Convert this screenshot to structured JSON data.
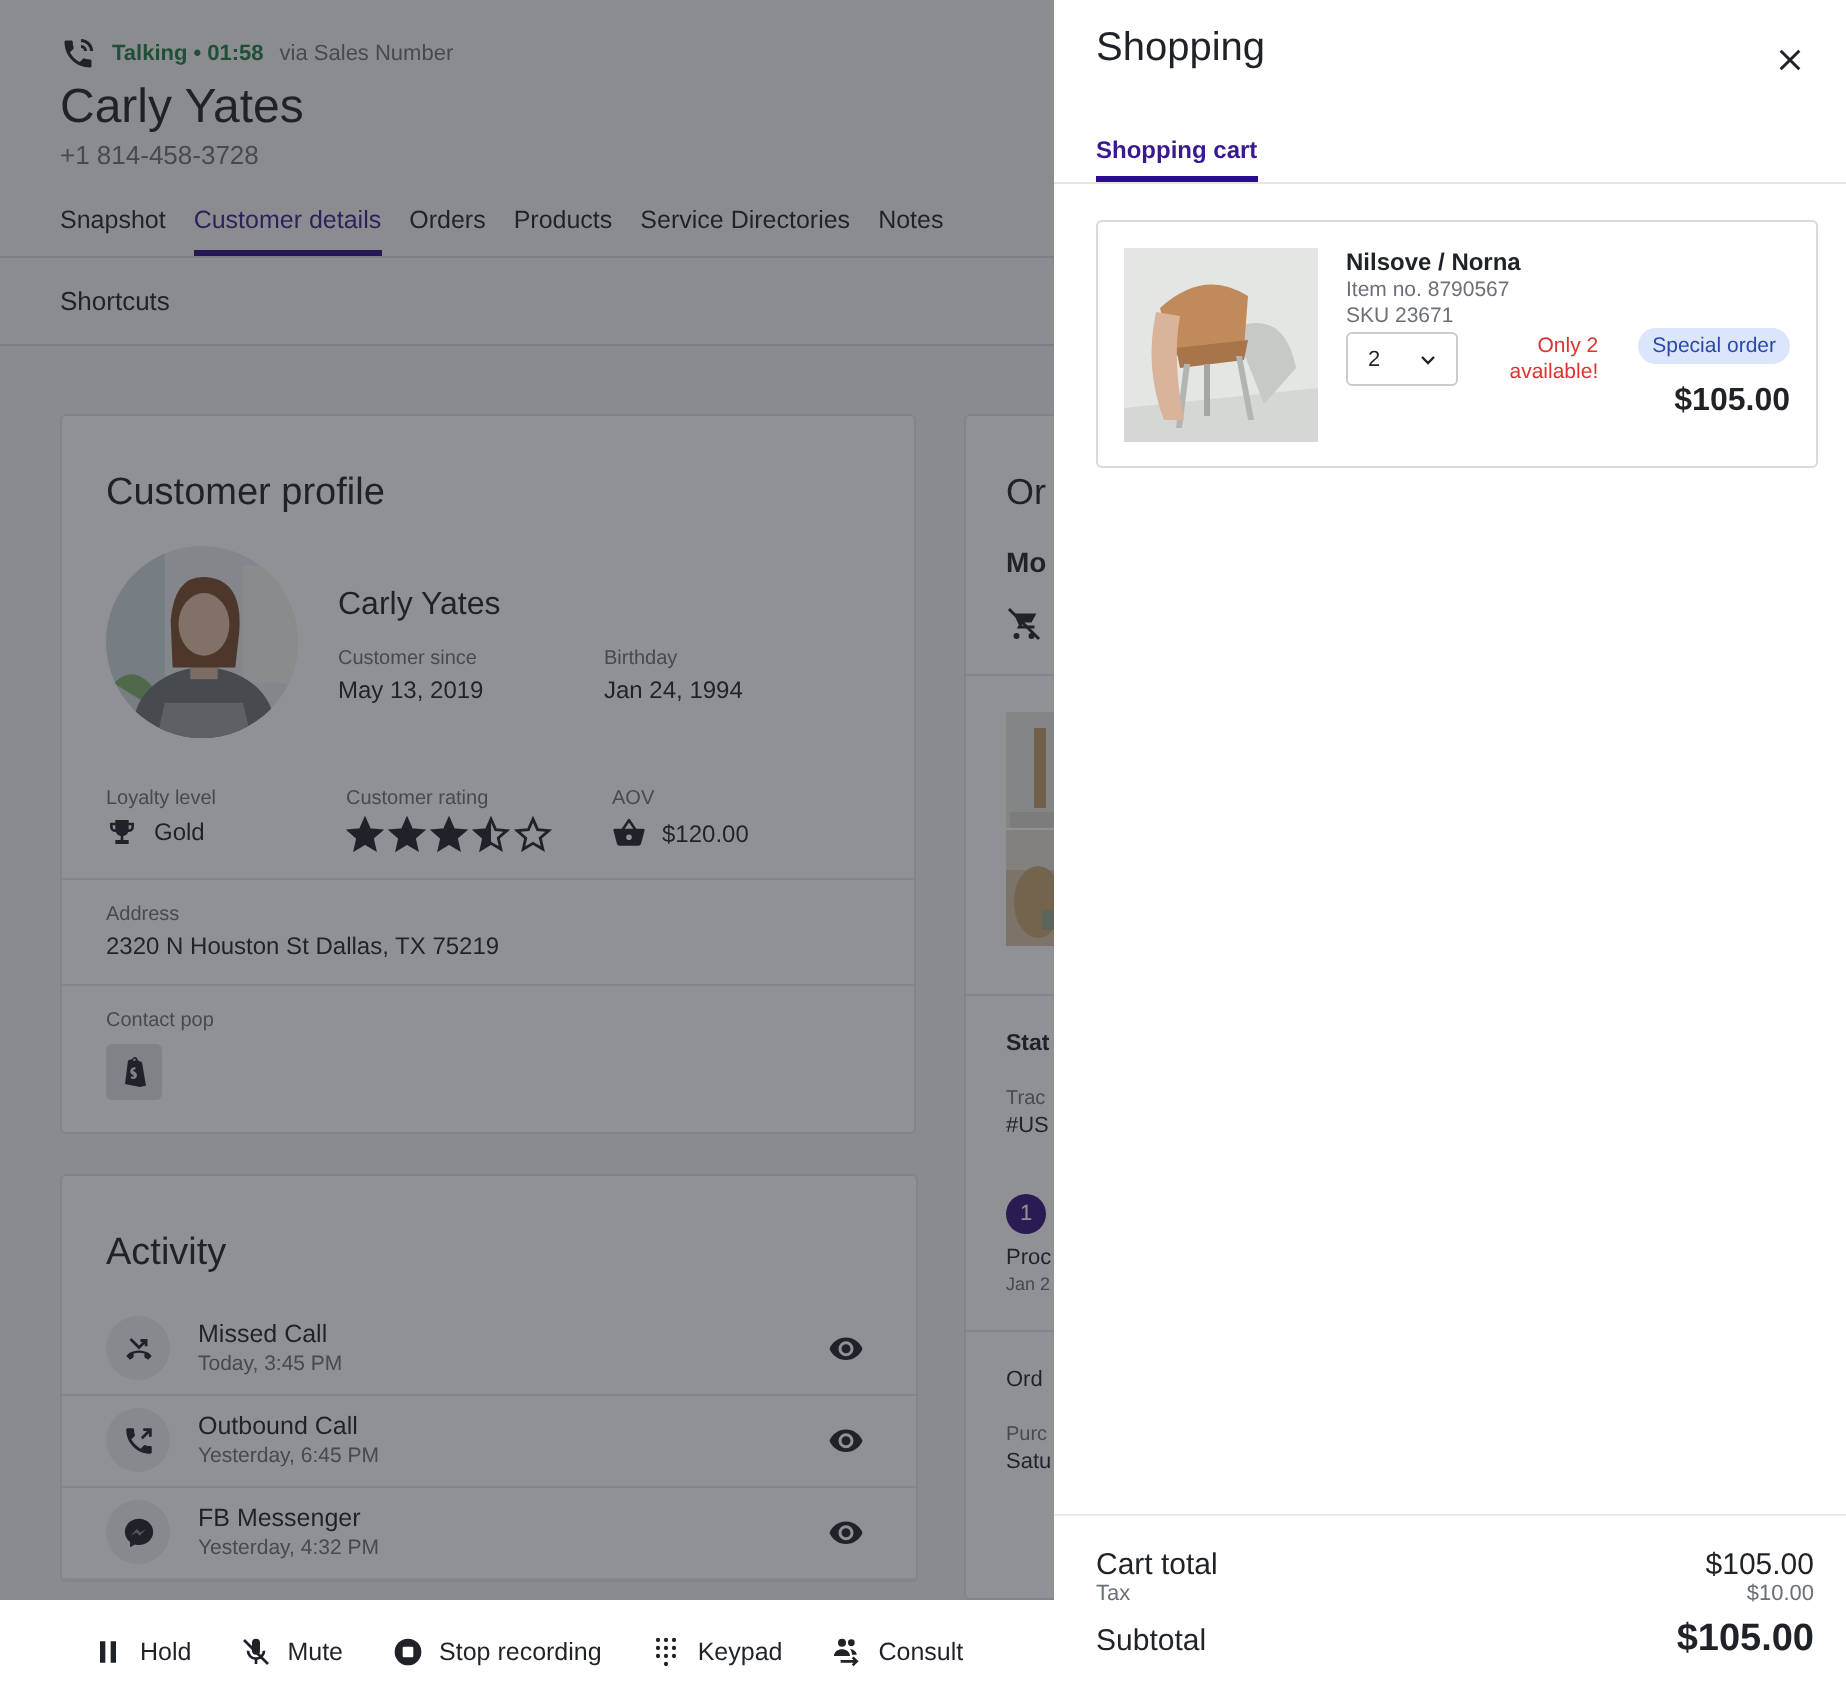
{
  "call": {
    "status": "Talking • 01:58",
    "via": "via Sales Number",
    "name": "Carly Yates",
    "phone": "+1 814-458-3728"
  },
  "tabs": [
    {
      "label": "Snapshot",
      "selected": false
    },
    {
      "label": "Customer details",
      "selected": true
    },
    {
      "label": "Orders",
      "selected": false
    },
    {
      "label": "Products",
      "selected": false
    },
    {
      "label": "Service Directories",
      "selected": false
    },
    {
      "label": "Notes",
      "selected": false
    }
  ],
  "shortcuts": "Shortcuts",
  "profile": {
    "title": "Customer profile",
    "name": "Carly Yates",
    "fields": [
      {
        "label": "Customer since",
        "value": "May 13, 2019"
      },
      {
        "label": "Birthday",
        "value": "Jan 24, 1994"
      }
    ],
    "loyalty": {
      "label": "Loyalty level",
      "value": "Gold"
    },
    "rating": {
      "label": "Customer rating",
      "stars": 3.5
    },
    "aov": {
      "label": "AOV",
      "value": "$120.00"
    },
    "address": {
      "label": "Address",
      "value": "2320 N Houston St Dallas, TX 75219"
    },
    "contact_pop": {
      "label": "Contact pop"
    }
  },
  "activity": {
    "title": "Activity",
    "items": [
      {
        "kind": "missed",
        "title": "Missed Call",
        "time": "Today, 3:45 PM"
      },
      {
        "kind": "outbound",
        "title": "Outbound Call",
        "time": "Yesterday, 6:45 PM"
      },
      {
        "kind": "messenger",
        "title": "FB Messenger",
        "time": "Yesterday, 4:32 PM"
      }
    ]
  },
  "orders_panel": {
    "title": "Or",
    "subtitle": "Mo",
    "status_label": "Stat",
    "tracking_label": "Trac",
    "tracking_value": "#US",
    "step_badge": "1",
    "step_label": "Proc",
    "step_date": "Jan 2",
    "order_label": "Ord",
    "purchase_label": "Purc",
    "purchase_value": "Satu"
  },
  "call_controls": [
    {
      "kind": "hold",
      "label": "Hold"
    },
    {
      "kind": "mute",
      "label": "Mute"
    },
    {
      "kind": "record",
      "label": "Stop recording"
    },
    {
      "kind": "keypad",
      "label": "Keypad"
    },
    {
      "kind": "consult",
      "label": "Consult"
    }
  ],
  "drawer": {
    "title": "Shopping",
    "tabs": [
      {
        "label": "Shopping cart",
        "selected": true
      }
    ],
    "items": [
      {
        "name": "Nilsove / Norna",
        "item_no": "Item no. 8790567",
        "sku": "SKU 23671",
        "quantity": "2",
        "stock_note": "Only 2 available!",
        "badge": "Special order",
        "price": "$105.00"
      }
    ],
    "summary": {
      "cart_total_label": "Cart total",
      "cart_total": "$105.00",
      "tax_label": "Tax",
      "tax": "$10.00",
      "subtotal_label": "Subtotal",
      "subtotal": "$105.00"
    }
  }
}
